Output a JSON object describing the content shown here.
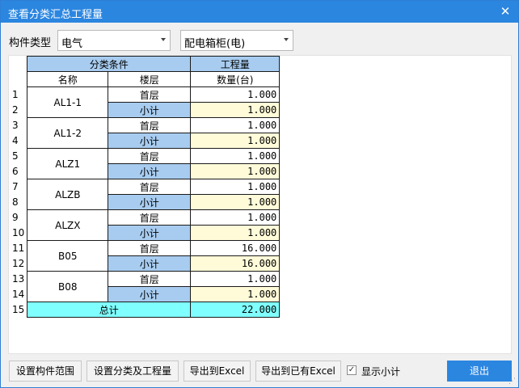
{
  "window": {
    "title": "查看分类汇总工程量"
  },
  "filters": {
    "component_type_label": "构件类型",
    "component_type_value": "电气",
    "subtype_value": "配电箱柜(电)"
  },
  "table": {
    "group_header_conditions": "分类条件",
    "group_header_quantity": "工程量",
    "col_name": "名称",
    "col_floor": "楼层",
    "col_qty": "数量(台)",
    "groups": [
      {
        "name": "AL1-1",
        "rows": [
          {
            "n": "1",
            "floor": "首层",
            "qty": "1.000"
          },
          {
            "n": "2",
            "floor": "小计",
            "qty": "1.000"
          }
        ]
      },
      {
        "name": "AL1-2",
        "rows": [
          {
            "n": "3",
            "floor": "首层",
            "qty": "1.000"
          },
          {
            "n": "4",
            "floor": "小计",
            "qty": "1.000"
          }
        ]
      },
      {
        "name": "ALZ1",
        "rows": [
          {
            "n": "5",
            "floor": "首层",
            "qty": "1.000"
          },
          {
            "n": "6",
            "floor": "小计",
            "qty": "1.000"
          }
        ]
      },
      {
        "name": "ALZB",
        "rows": [
          {
            "n": "7",
            "floor": "首层",
            "qty": "1.000"
          },
          {
            "n": "8",
            "floor": "小计",
            "qty": "1.000"
          }
        ]
      },
      {
        "name": "ALZX",
        "rows": [
          {
            "n": "9",
            "floor": "首层",
            "qty": "1.000"
          },
          {
            "n": "10",
            "floor": "小计",
            "qty": "1.000"
          }
        ]
      },
      {
        "name": "B05",
        "rows": [
          {
            "n": "11",
            "floor": "首层",
            "qty": "16.000"
          },
          {
            "n": "12",
            "floor": "小计",
            "qty": "16.000"
          }
        ]
      },
      {
        "name": "B08",
        "rows": [
          {
            "n": "13",
            "floor": "首层",
            "qty": "1.000"
          },
          {
            "n": "14",
            "floor": "小计",
            "qty": "1.000"
          }
        ]
      }
    ],
    "total": {
      "n": "15",
      "label": "总计",
      "qty": "22.000"
    }
  },
  "buttons": {
    "set_range": "设置构件范围",
    "set_category": "设置分类及工程量",
    "export_excel": "导出到Excel",
    "export_existing": "导出到已有Excel",
    "show_subtotal": "显示小计",
    "show_subtotal_checked": true,
    "exit": "退出"
  },
  "colors": {
    "titlebar": "#2b86e0",
    "header": "#a8ccf0",
    "subtotal_qty": "#fffbd9",
    "total": "#80ffff"
  }
}
